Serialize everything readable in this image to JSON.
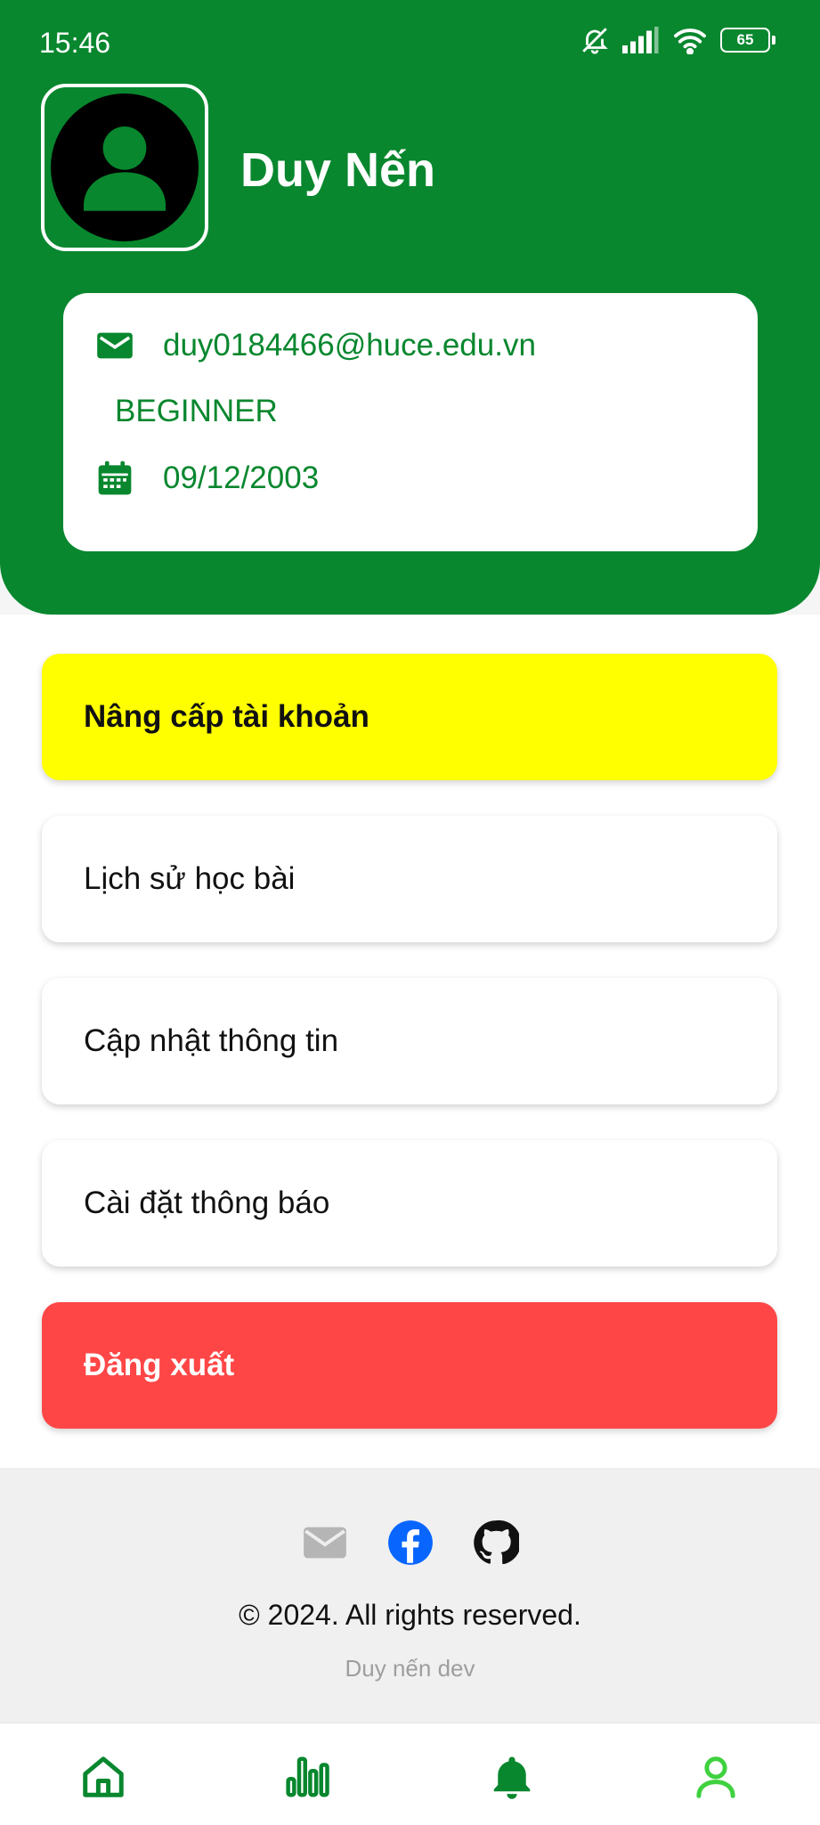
{
  "status_bar": {
    "time": "15:46",
    "battery": "65"
  },
  "profile": {
    "name": "Duy Nến",
    "email": "duy0184466@huce.edu.vn",
    "level": "BEGINNER",
    "birthdate": "09/12/2003"
  },
  "menu": {
    "upgrade": "Nâng cấp tài khoản",
    "history": "Lịch sử học bài",
    "update_info": "Cập nhật thông tin",
    "notification_settings": "Cài đặt thông báo",
    "logout": "Đăng xuất"
  },
  "footer": {
    "copyright": "© 2024. All rights reserved.",
    "dev": "Duy nến dev"
  },
  "colors": {
    "primary": "#08872e",
    "upgrade_bg": "#ffff00",
    "logout_bg": "#ff4646",
    "active_nav": "#3fd13f"
  },
  "icons": {
    "email": "mail-icon",
    "birthdate": "calendar-icon",
    "nav": [
      "home-icon",
      "chart-icon",
      "bell-icon",
      "user-icon"
    ]
  }
}
